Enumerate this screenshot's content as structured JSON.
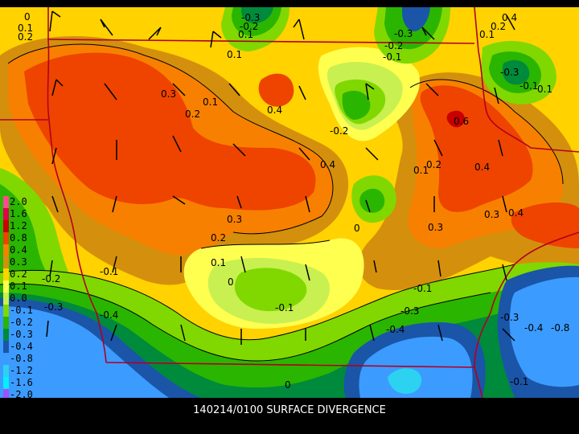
{
  "title": "140214/0100 SURFACE DIVERGENCE",
  "legend": [
    {
      "label": "2.0",
      "color": "#ff4b8c"
    },
    {
      "label": "1.6",
      "color": "#e0004a"
    },
    {
      "label": "1.2",
      "color": "#c80000"
    },
    {
      "label": "0.8",
      "color": "#ee4400"
    },
    {
      "label": "0.4",
      "color": "#f88000"
    },
    {
      "label": "0.3",
      "color": "#d4900c"
    },
    {
      "label": "0.2",
      "color": "#ffd200"
    },
    {
      "label": "0.1",
      "color": "#ffff50"
    },
    {
      "label": "0.0",
      "color": "#c8f050"
    },
    {
      "label": "-0.1",
      "color": "#80d800"
    },
    {
      "label": "-0.2",
      "color": "#2ab500"
    },
    {
      "label": "-0.3",
      "color": "#008a3c"
    },
    {
      "label": "-0.4",
      "color": "#1a55a8"
    },
    {
      "label": "-0.8",
      "color": "#3c9bff"
    },
    {
      "label": "-1.2",
      "color": "#2cd2f0"
    },
    {
      "label": "-1.6",
      "color": "#00f0ff"
    },
    {
      "label": "-2.0",
      "color": "#a050ff"
    }
  ],
  "contour_labels": [
    "0",
    "0.1",
    "0.2",
    "-0.3",
    "-0.2",
    "0.1",
    "-0.3",
    "-0.2",
    "-0.1",
    "0.4",
    "0.2",
    "0.1",
    "0.1",
    "0.3",
    "0.2",
    "0.1",
    "0.4",
    "-0.2",
    "0.6",
    "0.4",
    "0.1",
    "0.2",
    "0.4",
    "-0.3",
    "-0.1",
    "0.1",
    "0.3",
    "0.4",
    "0.3",
    "0",
    "0.3",
    "0.2",
    "0.1",
    "0",
    "-0.1",
    "-0.2",
    "-0.3",
    "-0.4",
    "-0.1",
    "-0.1",
    "-0.3",
    "-0.4",
    "-0.3",
    "-0.4",
    "-0.8",
    "-0.1",
    "0"
  ]
}
